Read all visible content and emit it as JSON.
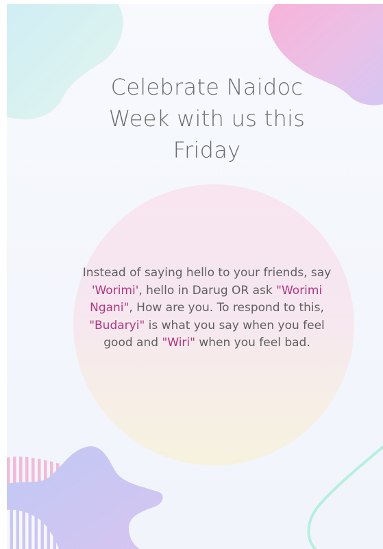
{
  "card": {
    "title_line_1": "Celebrate Naidoc",
    "title_line_2": "Week with us this",
    "title_line_3": "Friday",
    "message": {
      "part_1": "Instead of saying hello to your friends, say ",
      "word_1": "'Worimi'",
      "part_2": ", hello in Darug OR ask ",
      "word_2": "\"Worimi Ngani\"",
      "part_3": ", How are you. To respond to this, ",
      "word_3": "\"Budaryi\"",
      "part_4": " is what you say when you feel good and ",
      "word_4": "\"Wiri\"",
      "part_5": " when you feel bad."
    }
  },
  "colors": {
    "title_text": "#6c6c6c",
    "body_text": "#606060",
    "highlight_word": "#b2367e",
    "blob_teal": "#c7ecf0",
    "blob_pink": "#f3b9dc",
    "blob_lavender": "#c8cbf4",
    "stripe_pink": "#f1b3d6",
    "curve_mint": "#b8f0df"
  }
}
